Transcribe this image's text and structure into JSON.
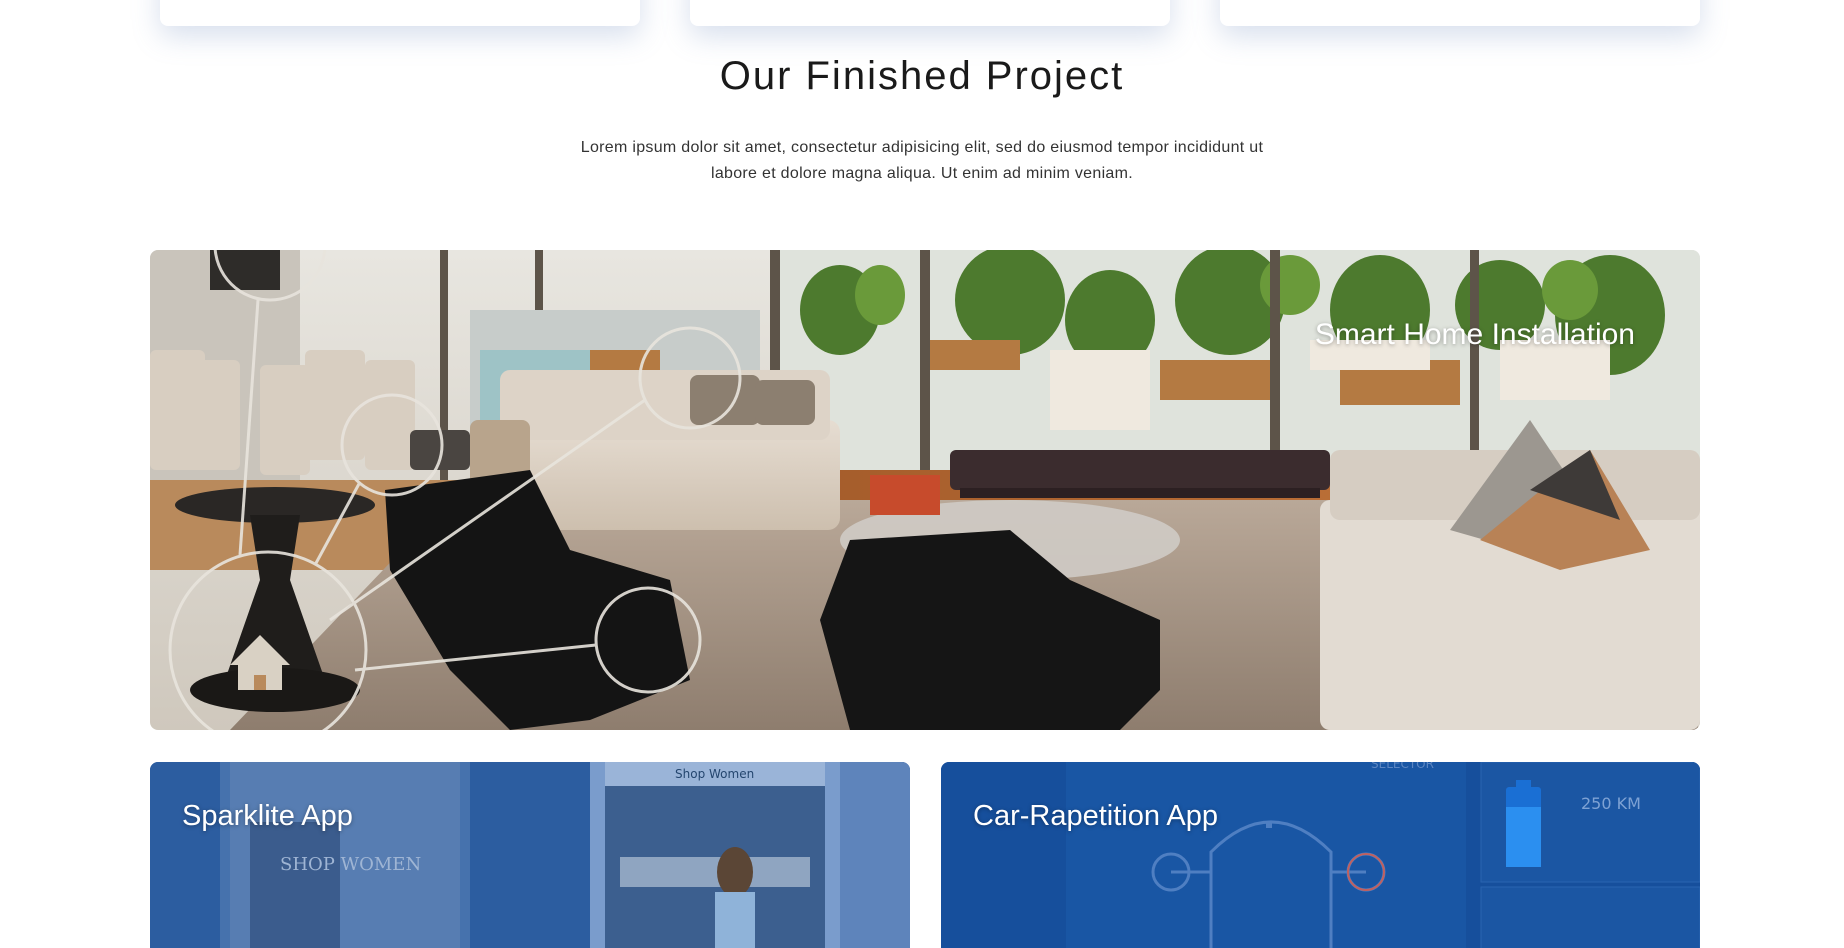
{
  "section": {
    "title": "Our Finished Project",
    "description_line1": "Lorem ipsum dolor sit amet, consectetur adipisicing elit, sed do eiusmod tempor incididunt ut",
    "description_line2": "labore et dolore magna aliqua. Ut enim ad minim veniam."
  },
  "projects": [
    {
      "title": "Smart Home Installation",
      "image": "smart-home-living-room-photo"
    },
    {
      "title": "Sparklite App",
      "image": "shopping-app-screens"
    },
    {
      "title": "Car-Rapetition App",
      "image": "car-dashboard-app-screens"
    }
  ],
  "mockup_text": {
    "shop_women_header": "Shop Women",
    "shop_women_banner": "SHOP WOMEN",
    "distance": "250 KM",
    "selector": "SELECTOR"
  },
  "colors": {
    "sparklite_overlay": "#2c5da0",
    "car_overlay": "#164f9c",
    "title_text": "#1a1a1a"
  }
}
